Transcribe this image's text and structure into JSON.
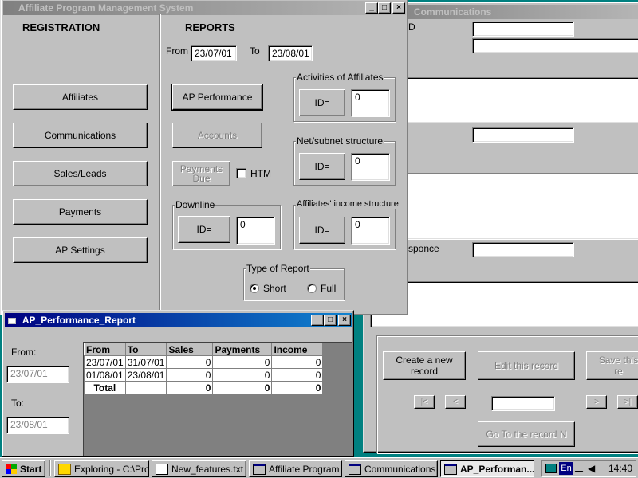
{
  "comm_window": {
    "title": "Communications",
    "id_label_fragment": "D",
    "response_label_fragment": "sponce",
    "buttons": {
      "create": "Create a new record",
      "edit": "Edit this record",
      "save": "Save this re",
      "first": "|<",
      "prev": "<",
      "next": ">",
      "last": ">|",
      "go_to": "Go To the record N"
    }
  },
  "main_window": {
    "title": "Affiliate Program Management System",
    "registration": {
      "heading": "REGISTRATION",
      "buttons": [
        "Affiliates",
        "Communications",
        "Sales/Leads",
        "Payments",
        "AP Settings"
      ]
    },
    "reports": {
      "heading": "REPORTS",
      "from_label": "From",
      "from_value": "23/07/01",
      "to_label": "To",
      "to_value": "23/08/01",
      "ap_performance": "AP Performance",
      "accounts": "Accounts",
      "payments_due": "Payments Due",
      "htm_label": "HTM",
      "downline": {
        "label": "Downline",
        "id_button": "ID=",
        "value": "0"
      },
      "activities": {
        "label": "Activities of Affiliates",
        "id_button": "ID=",
        "value": "0"
      },
      "net_structure": {
        "label": "Net/subnet structure",
        "id_button": "ID=",
        "value": "0"
      },
      "income_structure": {
        "label": "Affiliates' income structure",
        "id_button": "ID=",
        "value": "0"
      },
      "type_of_report": {
        "label": "Type of Report",
        "short": "Short",
        "full": "Full",
        "selected": "Short"
      }
    }
  },
  "report_window": {
    "title": "AP_Performance_Report",
    "from_label": "From:",
    "from_value": "23/07/01",
    "to_label": "To:",
    "to_value": "23/08/01",
    "table": {
      "columns": [
        "From",
        "To",
        "Sales",
        "Payments",
        "Income"
      ],
      "rows": [
        [
          "23/07/01",
          "31/07/01",
          "0",
          "0",
          "0"
        ],
        [
          "01/08/01",
          "23/08/01",
          "0",
          "0",
          "0"
        ]
      ],
      "total": [
        "Total",
        "",
        "0",
        "0",
        "0"
      ]
    }
  },
  "taskbar": {
    "start": "Start",
    "tasks": [
      "Exploring - C:\\Proj...",
      "New_features.txt ...",
      "Affiliate Program ...",
      "Communications",
      "AP_Performan..."
    ],
    "clock": "14:40",
    "lang": "En"
  },
  "colors": {
    "desktop": "#008080",
    "title_active": "#000080",
    "face": "#c0c0c0"
  }
}
